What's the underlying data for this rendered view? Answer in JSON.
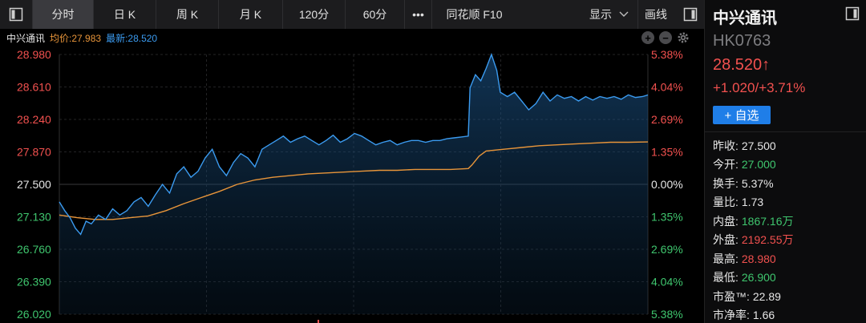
{
  "toolbar": {
    "tabs": [
      {
        "label": "分时",
        "active": true
      },
      {
        "label": "日 K"
      },
      {
        "label": "周 K"
      },
      {
        "label": "月 K"
      },
      {
        "label": "120分"
      },
      {
        "label": "60分"
      },
      {
        "label": "•••"
      },
      {
        "label": "同花顺 F10"
      }
    ],
    "display_label": "显示",
    "draw_label": "画线"
  },
  "legend": {
    "name": "中兴通讯",
    "avg": "均价:27.983",
    "last": "最新:28.520"
  },
  "colors": {
    "up": "#f2514f",
    "down": "#3fc66e",
    "price_line": "#3b9bf0",
    "avg_line": "#e8953a",
    "accent": "#1f7ee8"
  },
  "quote": {
    "name": "中兴通讯",
    "code": "HK0763",
    "price": "28.520↑",
    "change": "+1.020/+3.71%",
    "watch_button": "+ 自选"
  },
  "stats": [
    {
      "k": "昨收:",
      "v": "27.500",
      "color": "white"
    },
    {
      "k": "今开:",
      "v": "27.000",
      "color": "green"
    },
    {
      "k": "换手:",
      "v": "5.37%",
      "color": "white"
    },
    {
      "k": "量比:",
      "v": "1.73",
      "color": "white"
    },
    {
      "k": "内盘:",
      "v": "1867.16万",
      "color": "green"
    },
    {
      "k": "外盘:",
      "v": "2192.55万",
      "color": "red"
    },
    {
      "k": "最高:",
      "v": "28.980",
      "color": "red"
    },
    {
      "k": "最低:",
      "v": "26.900",
      "color": "green"
    },
    {
      "k": "市盈™:",
      "v": "22.89",
      "color": "white"
    },
    {
      "k": "市净率:",
      "v": "1.66",
      "color": "white"
    }
  ],
  "chart_data": {
    "type": "line",
    "ylim": [
      26.02,
      28.98
    ],
    "prev_close": 27.5,
    "total_points": 331,
    "left_ticks": [
      "28.980",
      "28.610",
      "28.240",
      "27.870",
      "27.500",
      "27.130",
      "26.760",
      "26.390",
      "26.020"
    ],
    "right_ticks": [
      "5.38%",
      "4.04%",
      "2.69%",
      "1.35%",
      "0.00%",
      "1.35%",
      "2.69%",
      "4.04%",
      "5.38%"
    ],
    "grid": true,
    "series": [
      {
        "key": "price",
        "points": [
          [
            0,
            27.3
          ],
          [
            3,
            27.2
          ],
          [
            6,
            27.12
          ],
          [
            9,
            27.0
          ],
          [
            12,
            26.93
          ],
          [
            15,
            27.08
          ],
          [
            18,
            27.05
          ],
          [
            22,
            27.15
          ],
          [
            26,
            27.1
          ],
          [
            30,
            27.22
          ],
          [
            34,
            27.15
          ],
          [
            38,
            27.2
          ],
          [
            42,
            27.3
          ],
          [
            46,
            27.35
          ],
          [
            50,
            27.25
          ],
          [
            54,
            27.38
          ],
          [
            58,
            27.5
          ],
          [
            62,
            27.4
          ],
          [
            66,
            27.62
          ],
          [
            70,
            27.7
          ],
          [
            74,
            27.58
          ],
          [
            78,
            27.65
          ],
          [
            82,
            27.8
          ],
          [
            86,
            27.9
          ],
          [
            90,
            27.7
          ],
          [
            94,
            27.6
          ],
          [
            98,
            27.75
          ],
          [
            102,
            27.85
          ],
          [
            106,
            27.8
          ],
          [
            110,
            27.7
          ],
          [
            114,
            27.9
          ],
          [
            118,
            27.95
          ],
          [
            122,
            28.0
          ],
          [
            126,
            28.05
          ],
          [
            130,
            27.98
          ],
          [
            134,
            28.02
          ],
          [
            138,
            28.05
          ],
          [
            142,
            28.0
          ],
          [
            146,
            27.95
          ],
          [
            150,
            28.0
          ],
          [
            154,
            28.06
          ],
          [
            158,
            27.98
          ],
          [
            162,
            28.02
          ],
          [
            166,
            28.08
          ],
          [
            170,
            28.05
          ],
          [
            174,
            28.0
          ],
          [
            178,
            27.95
          ],
          [
            182,
            27.98
          ],
          [
            186,
            28.0
          ],
          [
            190,
            27.95
          ],
          [
            194,
            27.98
          ],
          [
            198,
            28.0
          ],
          [
            202,
            28.0
          ],
          [
            206,
            27.98
          ],
          [
            210,
            28.0
          ],
          [
            214,
            28.0
          ],
          [
            218,
            28.02
          ],
          [
            222,
            28.03
          ],
          [
            226,
            28.04
          ],
          [
            230,
            28.05
          ],
          [
            231,
            28.6
          ],
          [
            234,
            28.75
          ],
          [
            237,
            28.68
          ],
          [
            240,
            28.82
          ],
          [
            243,
            28.98
          ],
          [
            246,
            28.8
          ],
          [
            248,
            28.55
          ],
          [
            252,
            28.5
          ],
          [
            256,
            28.55
          ],
          [
            260,
            28.45
          ],
          [
            264,
            28.35
          ],
          [
            268,
            28.42
          ],
          [
            272,
            28.55
          ],
          [
            276,
            28.45
          ],
          [
            280,
            28.52
          ],
          [
            284,
            28.48
          ],
          [
            288,
            28.5
          ],
          [
            292,
            28.45
          ],
          [
            296,
            28.5
          ],
          [
            300,
            28.46
          ],
          [
            304,
            28.5
          ],
          [
            308,
            28.48
          ],
          [
            312,
            28.5
          ],
          [
            316,
            28.47
          ],
          [
            320,
            28.52
          ],
          [
            324,
            28.49
          ],
          [
            328,
            28.5
          ],
          [
            331,
            28.52
          ]
        ]
      },
      {
        "key": "avg",
        "points": [
          [
            0,
            27.15
          ],
          [
            10,
            27.12
          ],
          [
            20,
            27.1
          ],
          [
            30,
            27.1
          ],
          [
            40,
            27.12
          ],
          [
            50,
            27.14
          ],
          [
            60,
            27.2
          ],
          [
            70,
            27.28
          ],
          [
            80,
            27.35
          ],
          [
            90,
            27.42
          ],
          [
            100,
            27.5
          ],
          [
            110,
            27.55
          ],
          [
            120,
            27.58
          ],
          [
            130,
            27.6
          ],
          [
            140,
            27.62
          ],
          [
            150,
            27.63
          ],
          [
            160,
            27.64
          ],
          [
            170,
            27.65
          ],
          [
            180,
            27.66
          ],
          [
            190,
            27.66
          ],
          [
            200,
            27.67
          ],
          [
            210,
            27.67
          ],
          [
            220,
            27.67
          ],
          [
            230,
            27.68
          ],
          [
            232,
            27.72
          ],
          [
            236,
            27.82
          ],
          [
            240,
            27.88
          ],
          [
            250,
            27.9
          ],
          [
            260,
            27.92
          ],
          [
            270,
            27.94
          ],
          [
            280,
            27.95
          ],
          [
            290,
            27.96
          ],
          [
            300,
            27.97
          ],
          [
            310,
            27.98
          ],
          [
            320,
            27.98
          ],
          [
            331,
            27.983
          ]
        ]
      }
    ]
  }
}
